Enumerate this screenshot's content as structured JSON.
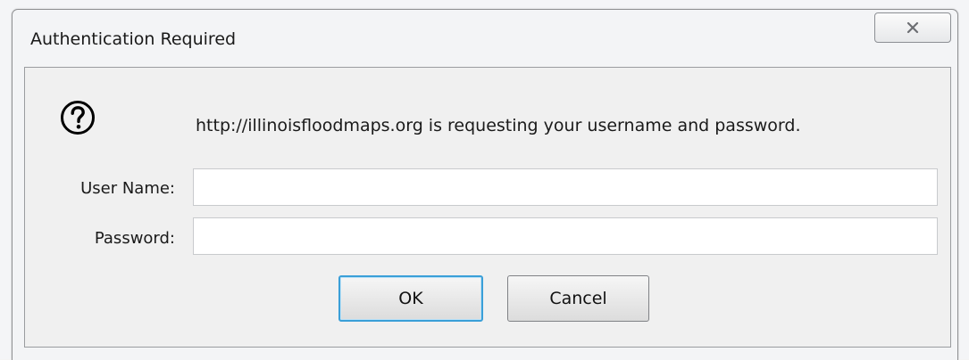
{
  "dialog": {
    "title": "Authentication Required",
    "close_icon": "close-x-icon",
    "message_icon": "question-mark-icon",
    "message": "http://illinoisfloodmaps.org is requesting your username and password.",
    "fields": {
      "username": {
        "label": "User Name:",
        "value": "",
        "placeholder": ""
      },
      "password": {
        "label": "Password:",
        "value": "",
        "placeholder": ""
      }
    },
    "buttons": {
      "ok_label": "OK",
      "cancel_label": "Cancel"
    },
    "colors": {
      "focus_border": "#3a9fd8",
      "background": "#f0f0f0"
    }
  }
}
